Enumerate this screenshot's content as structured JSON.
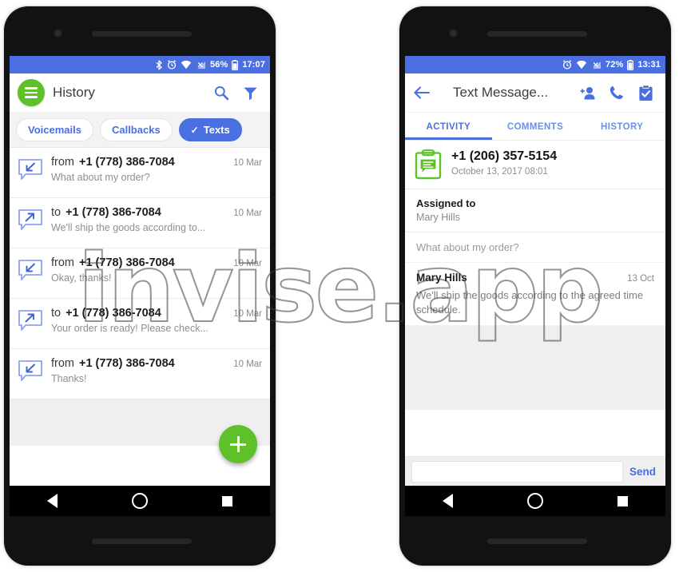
{
  "watermark": {
    "text": "invise.app"
  },
  "phone_left": {
    "status_bar": {
      "icons": [
        "bluetooth-icon",
        "alarm-icon",
        "wifi-icon",
        "cell-signal-icon"
      ],
      "battery_percent": "56%",
      "battery_icon": "battery-icon",
      "time": "17:07"
    },
    "app_bar": {
      "menu_icon": "hamburger-menu-icon",
      "title": "History",
      "search_icon": "search-icon",
      "filter_icon": "filter-funnel-icon"
    },
    "filters": [
      {
        "label": "Voicemails",
        "active": false
      },
      {
        "label": "Callbacks",
        "active": false
      },
      {
        "label": "Texts",
        "active": true,
        "check": "✓"
      }
    ],
    "messages": [
      {
        "direction": "from",
        "number": "+1 (778) 386-7084",
        "date": "10 Mar",
        "preview": "What about my order?",
        "icon": "incoming-message-icon"
      },
      {
        "direction": "to",
        "number": "+1 (778) 386-7084",
        "date": "10 Mar",
        "preview": "We'll ship the goods according to...",
        "icon": "outgoing-message-icon"
      },
      {
        "direction": "from",
        "number": "+1 (778) 386-7084",
        "date": "10 Mar",
        "preview": "Okay, thanks!",
        "icon": "incoming-message-icon"
      },
      {
        "direction": "to",
        "number": "+1 (778) 386-7084",
        "date": "10 Mar",
        "preview": "Your order is ready! Please check...",
        "icon": "outgoing-message-icon"
      },
      {
        "direction": "from",
        "number": "+1 (778) 386-7084",
        "date": "10 Mar",
        "preview": "Thanks!",
        "icon": "incoming-message-icon"
      }
    ],
    "fab": {
      "icon": "plus-icon",
      "label": "+"
    },
    "nav_bar": {
      "back": "back-triangle-icon",
      "home": "home-circle-icon",
      "recents": "recents-square-icon"
    }
  },
  "phone_right": {
    "status_bar": {
      "icons": [
        "alarm-icon",
        "wifi-icon",
        "cell-signal-icon"
      ],
      "battery_percent": "72%",
      "battery_icon": "battery-icon",
      "time": "13:31"
    },
    "app_bar": {
      "back_icon": "back-arrow-icon",
      "title": "Text Message...",
      "add_person_icon": "add-person-icon",
      "call_icon": "phone-call-icon",
      "task_icon": "clipboard-check-icon"
    },
    "tabs": [
      {
        "label": "ACTIVITY",
        "active": true
      },
      {
        "label": "COMMENTS",
        "active": false
      },
      {
        "label": "HISTORY",
        "active": false
      }
    ],
    "detail": {
      "icon": "clipboard-message-icon",
      "number": "+1 (206) 357-5154",
      "timestamp": "October 13, 2017 08:01"
    },
    "assigned": {
      "label": "Assigned to",
      "value": "Mary Hills"
    },
    "thread": [
      {
        "author": "",
        "when": "",
        "text": "What about my order?",
        "incoming": true
      },
      {
        "author": "Mary Hills",
        "when": "13 Oct",
        "text": "We'll ship the goods according to the agreed time schedule.",
        "incoming": false
      }
    ],
    "composer": {
      "placeholder": "",
      "value": "",
      "send_label": "Send"
    },
    "nav_bar": {
      "back": "back-triangle-icon",
      "home": "home-circle-icon",
      "recents": "recents-square-icon"
    }
  },
  "colors": {
    "status_blue": "#4a6fe0",
    "accent_blue": "#4a6fe0",
    "green": "#5fc12a",
    "grey_bg": "#efefef"
  }
}
